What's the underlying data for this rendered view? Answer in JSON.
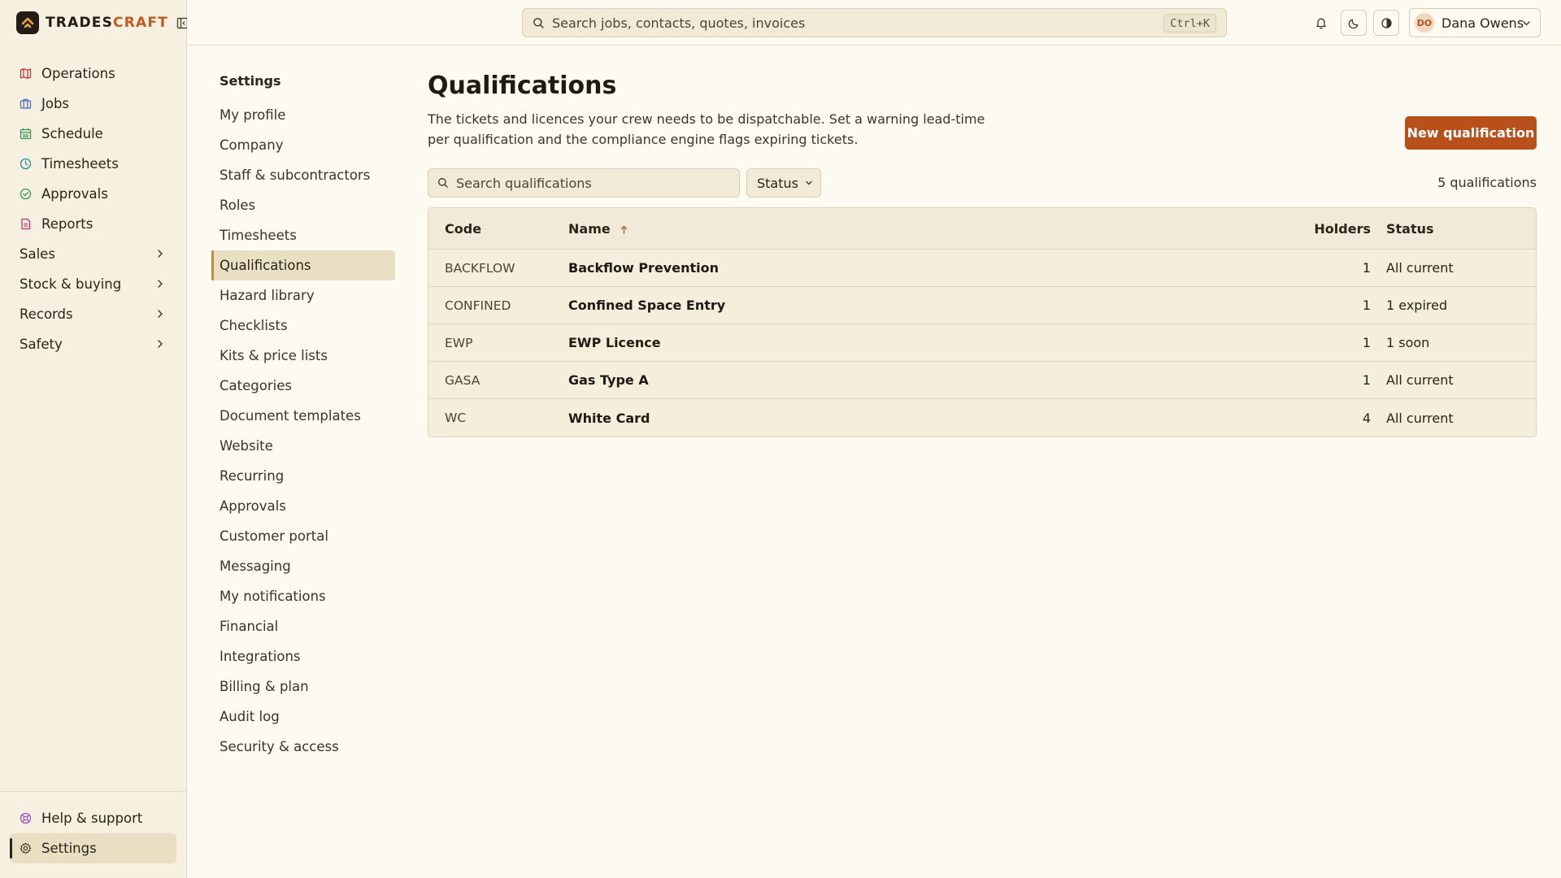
{
  "app": {
    "brand_prefix": "TRADES",
    "brand_suffix": "CRAFT"
  },
  "sidebar": {
    "items": [
      {
        "label": "Operations",
        "icon": "map-icon",
        "color": "#c9302c"
      },
      {
        "label": "Jobs",
        "icon": "briefcase-icon",
        "color": "#3b6fd4"
      },
      {
        "label": "Schedule",
        "icon": "calendar-icon",
        "color": "#2e9a4b"
      },
      {
        "label": "Timesheets",
        "icon": "clock-icon",
        "color": "#1e8f9e"
      },
      {
        "label": "Approvals",
        "icon": "check-circle-icon",
        "color": "#2e9a4b"
      },
      {
        "label": "Reports",
        "icon": "report-icon",
        "color": "#c2306b"
      }
    ],
    "groups": [
      {
        "label": "Sales"
      },
      {
        "label": "Stock & buying"
      },
      {
        "label": "Records"
      },
      {
        "label": "Safety"
      }
    ],
    "bottom": {
      "help_label": "Help & support",
      "settings_label": "Settings"
    }
  },
  "topbar": {
    "search_placeholder": "Search jobs, contacts, quotes, invoices",
    "shortcut": "Ctrl+K",
    "user": {
      "initials": "DO",
      "name": "Dana Owens"
    }
  },
  "settings_nav": {
    "title": "Settings",
    "items": [
      "My profile",
      "Company",
      "Staff & subcontractors",
      "Roles",
      "Timesheets",
      "Qualifications",
      "Hazard library",
      "Checklists",
      "Kits & price lists",
      "Categories",
      "Document templates",
      "Website",
      "Recurring",
      "Approvals",
      "Customer portal",
      "Messaging",
      "My notifications",
      "Financial",
      "Integrations",
      "Billing & plan",
      "Audit log",
      "Security & access"
    ],
    "active": "Qualifications"
  },
  "page": {
    "title": "Qualifications",
    "description": "The tickets and licences your crew needs to be dispatchable. Set a warning lead-time per qualification and the compliance engine flags expiring tickets.",
    "primary_button": "New qualification",
    "search_placeholder": "Search qualifications",
    "status_filter": "Status",
    "count": "5 qualifications"
  },
  "table": {
    "columns": {
      "code": "Code",
      "name": "Name",
      "holders": "Holders",
      "status": "Status"
    },
    "sort": {
      "column": "Name",
      "direction": "asc"
    },
    "rows": [
      {
        "code": "BACKFLOW",
        "name": "Backflow Prevention",
        "holders": "1",
        "status": "All current"
      },
      {
        "code": "CONFINED",
        "name": "Confined Space Entry",
        "holders": "1",
        "status": "1 expired"
      },
      {
        "code": "EWP",
        "name": "EWP Licence",
        "holders": "1",
        "status": "1 soon"
      },
      {
        "code": "GASA",
        "name": "Gas Type A",
        "holders": "1",
        "status": "All current"
      },
      {
        "code": "WC",
        "name": "White Card",
        "holders": "4",
        "status": "All current"
      }
    ]
  },
  "colors": {
    "accent": "#b8501b",
    "active_bg": "#e9dfc3",
    "page_bg": "#fdfaf2"
  }
}
